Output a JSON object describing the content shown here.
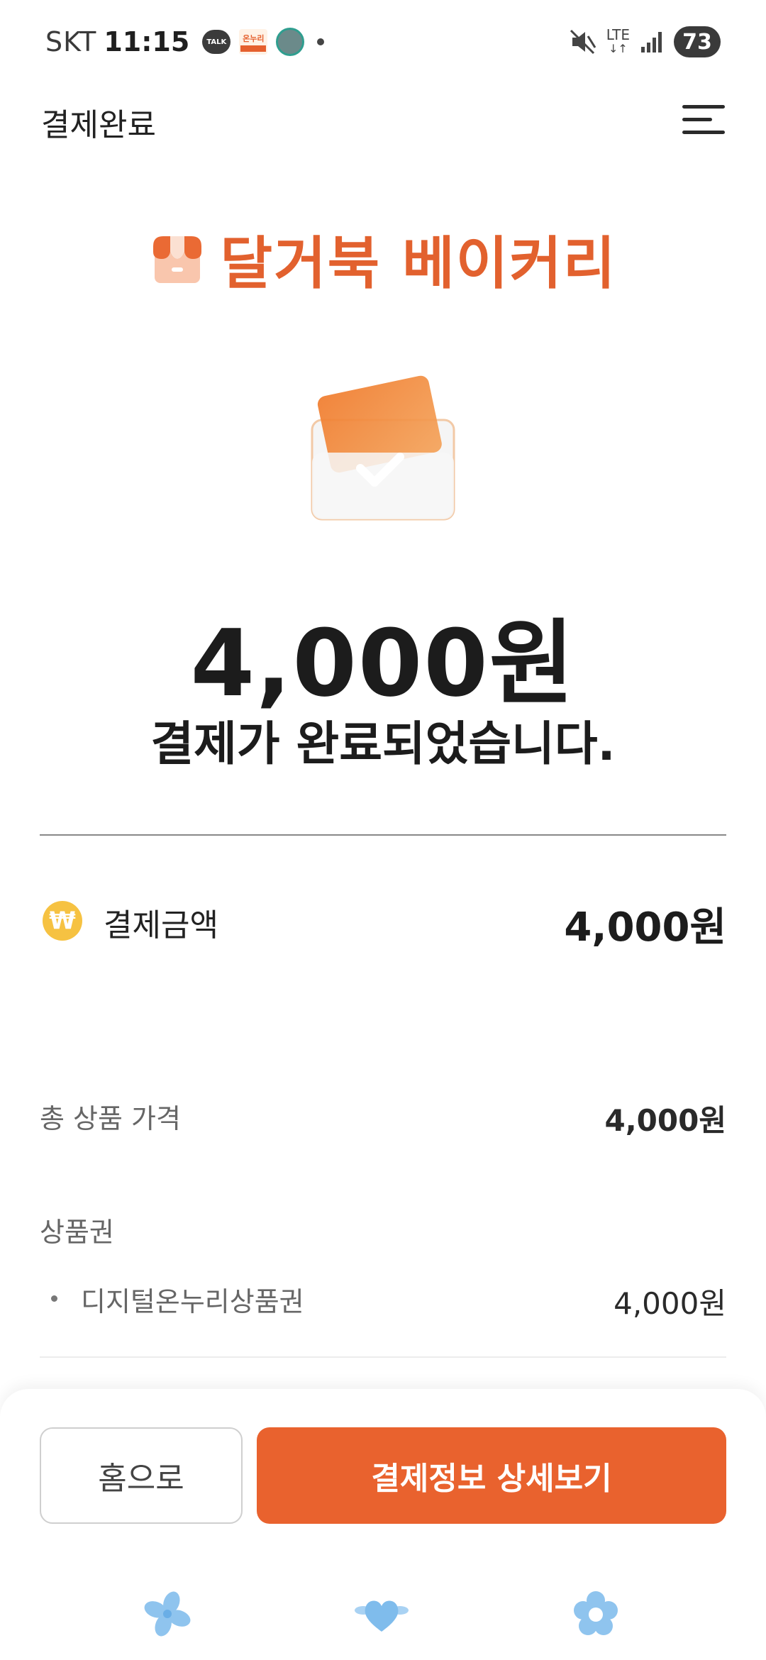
{
  "status_bar": {
    "carrier": "SKT",
    "time": "11:15",
    "talk_badge": "TALK",
    "onnuri_badge": "온누리",
    "network": "LTE",
    "battery": "73"
  },
  "header": {
    "title": "결제완료",
    "menu_icon": "hamburger-menu-icon"
  },
  "store": {
    "name": "달거북 베이커리",
    "icon": "store-icon"
  },
  "payment": {
    "amount": "4,000원",
    "message": "결제가 완료되었습니다."
  },
  "summary": {
    "paid_label": "결제금액",
    "paid_value": "4,000원",
    "won_symbol": "₩",
    "total_label": "총 상품 가격",
    "total_value": "4,000원",
    "voucher_section": "상품권",
    "voucher_item_label": "디지털온누리상품권",
    "voucher_item_value": "4,000원"
  },
  "actions": {
    "home_label": "홈으로",
    "detail_label": "결제정보 상세보기"
  },
  "colors": {
    "accent": "#e9622e",
    "store_name": "#e2612e",
    "won_badge": "#f6c242"
  }
}
